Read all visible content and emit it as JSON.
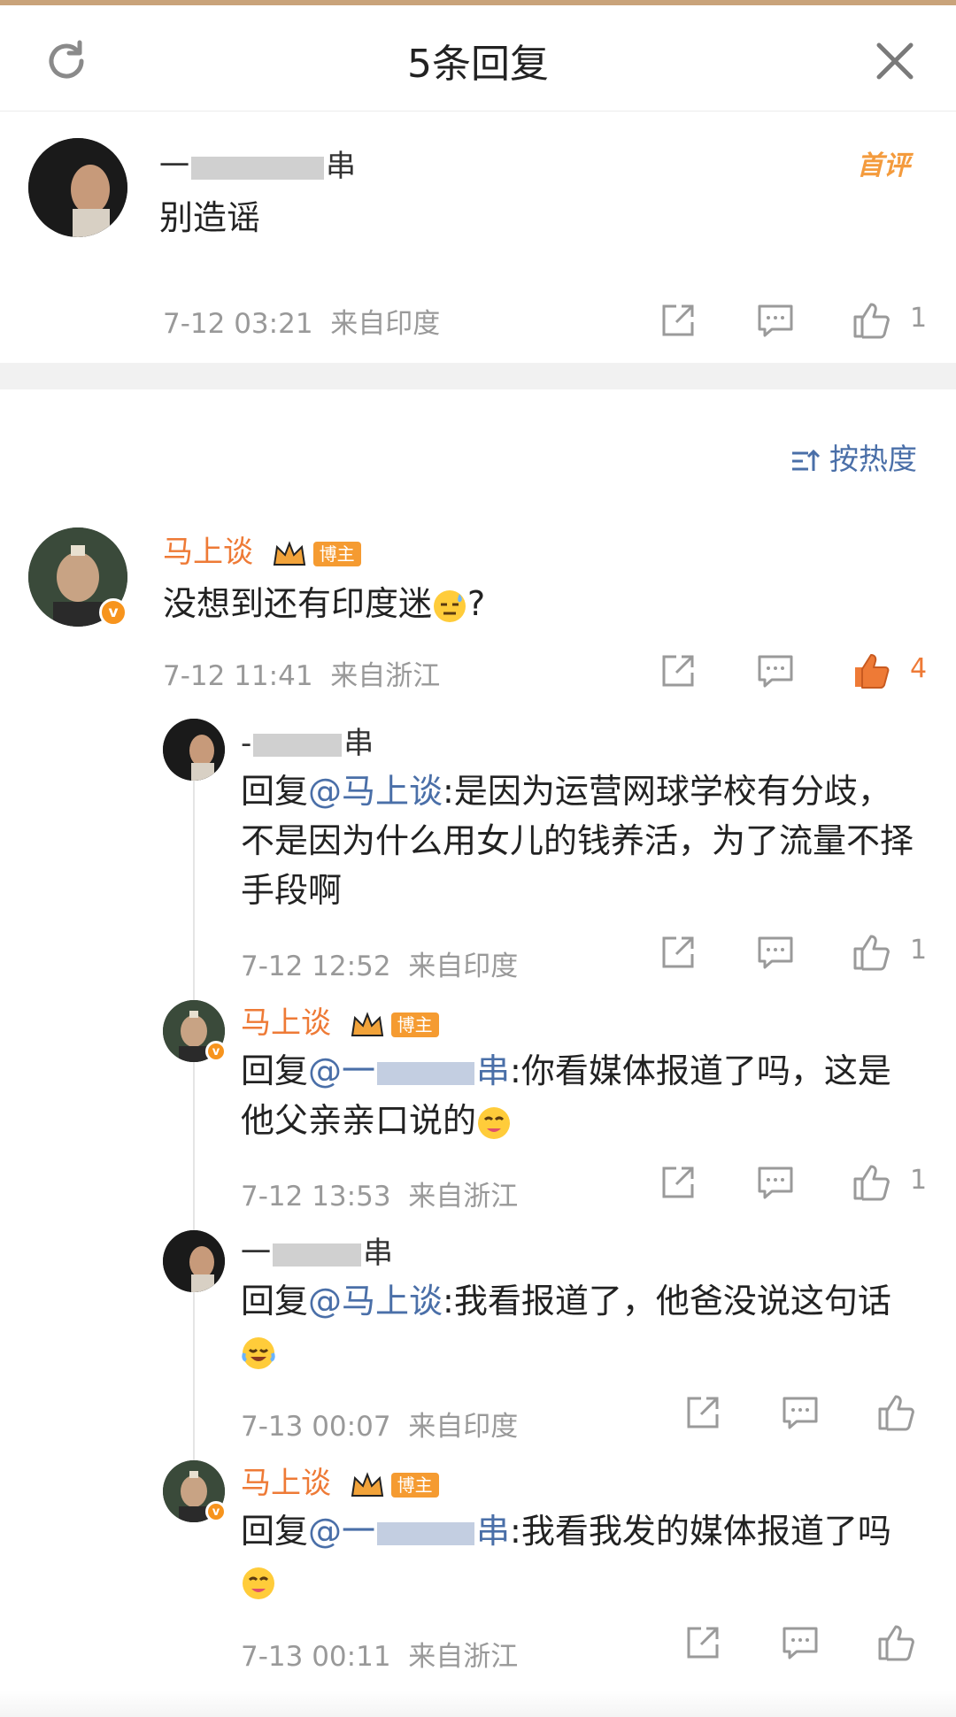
{
  "header": {
    "title": "5条回复"
  },
  "first_comment": {
    "username_prefix": "一",
    "username_suffix": "串",
    "badge": "首评",
    "text": "别造谣",
    "time": "7-12 03:21",
    "location": "来自印度",
    "likes": "1"
  },
  "sort_label": "按热度",
  "main_comment": {
    "username": "马上谈",
    "badge": "博主",
    "text": "没想到还有印度迷",
    "text_tail": "?",
    "time": "7-12 11:41",
    "location": "来自浙江",
    "likes": "4"
  },
  "replies": [
    {
      "username_prefix": "-",
      "username_suffix": "串",
      "reply_prefix": "回复",
      "mention": "@马上谈",
      "text": ":是因为运营网球学校有分歧，不是因为什么用女儿的钱养活，为了流量不择手段啊",
      "time": "7-12 12:52",
      "location": "来自印度",
      "likes": "1"
    },
    {
      "username": "马上谈",
      "badge": "博主",
      "reply_prefix": "回复",
      "mention_prefix": "@一",
      "mention_suffix": "串",
      "text": ":你看媒体报道了吗，这是他父亲亲口说的",
      "time": "7-12 13:53",
      "location": "来自浙江",
      "likes": "1"
    },
    {
      "username_prefix": "一",
      "username_suffix": "串",
      "reply_prefix": "回复",
      "mention": "@马上谈",
      "text": ":我看报道了，他爸没说这句话",
      "time": "7-13 00:07",
      "location": "来自印度",
      "likes": ""
    },
    {
      "username": "马上谈",
      "badge": "博主",
      "reply_prefix": "回复",
      "mention_prefix": "@一",
      "mention_suffix": "串",
      "text": ":我看我发的媒体报道了吗",
      "time": "7-13 00:11",
      "location": "来自浙江",
      "likes": ""
    }
  ],
  "icons": {
    "refresh": "refresh-icon",
    "close": "close-icon",
    "share": "share-icon",
    "comment": "comment-icon",
    "like": "thumbs-up-icon"
  },
  "colors": {
    "accent": "#ee7a36",
    "link": "#4a6fa8",
    "muted": "#999999"
  }
}
